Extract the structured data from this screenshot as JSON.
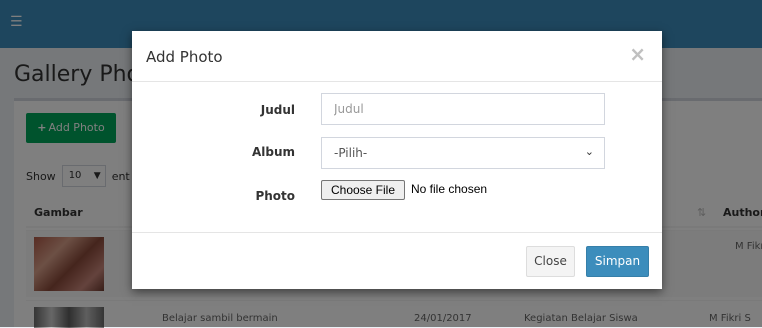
{
  "background": {
    "menu_icon": "hamburger-icon",
    "page_title": "Gallery Photo",
    "add_button": "Add Photo",
    "show_label": "Show",
    "show_value": "10",
    "entries_label": "ent",
    "table": {
      "headers": [
        "Gambar",
        "Author"
      ],
      "sort_icon": "sort-icon",
      "row1": {
        "author": "M Fikri S"
      },
      "row2": {
        "title": "Belajar sambil bermain",
        "date": "24/01/2017",
        "album": "Kegiatan Belajar Siswa",
        "author": "M Fikri S"
      }
    }
  },
  "modal": {
    "title": "Add Photo",
    "close_icon": "close-icon",
    "fields": {
      "judul": {
        "label": "Judul",
        "placeholder": "Judul",
        "value": ""
      },
      "album": {
        "label": "Album",
        "selected": "-Pilih-"
      },
      "photo": {
        "label": "Photo",
        "button": "Choose File",
        "status": "No file chosen"
      }
    },
    "footer": {
      "close": "Close",
      "save": "Simpan"
    }
  },
  "colors": {
    "header": "#3c8dbc",
    "primary": "#3c8dbc",
    "success": "#00a65a"
  }
}
